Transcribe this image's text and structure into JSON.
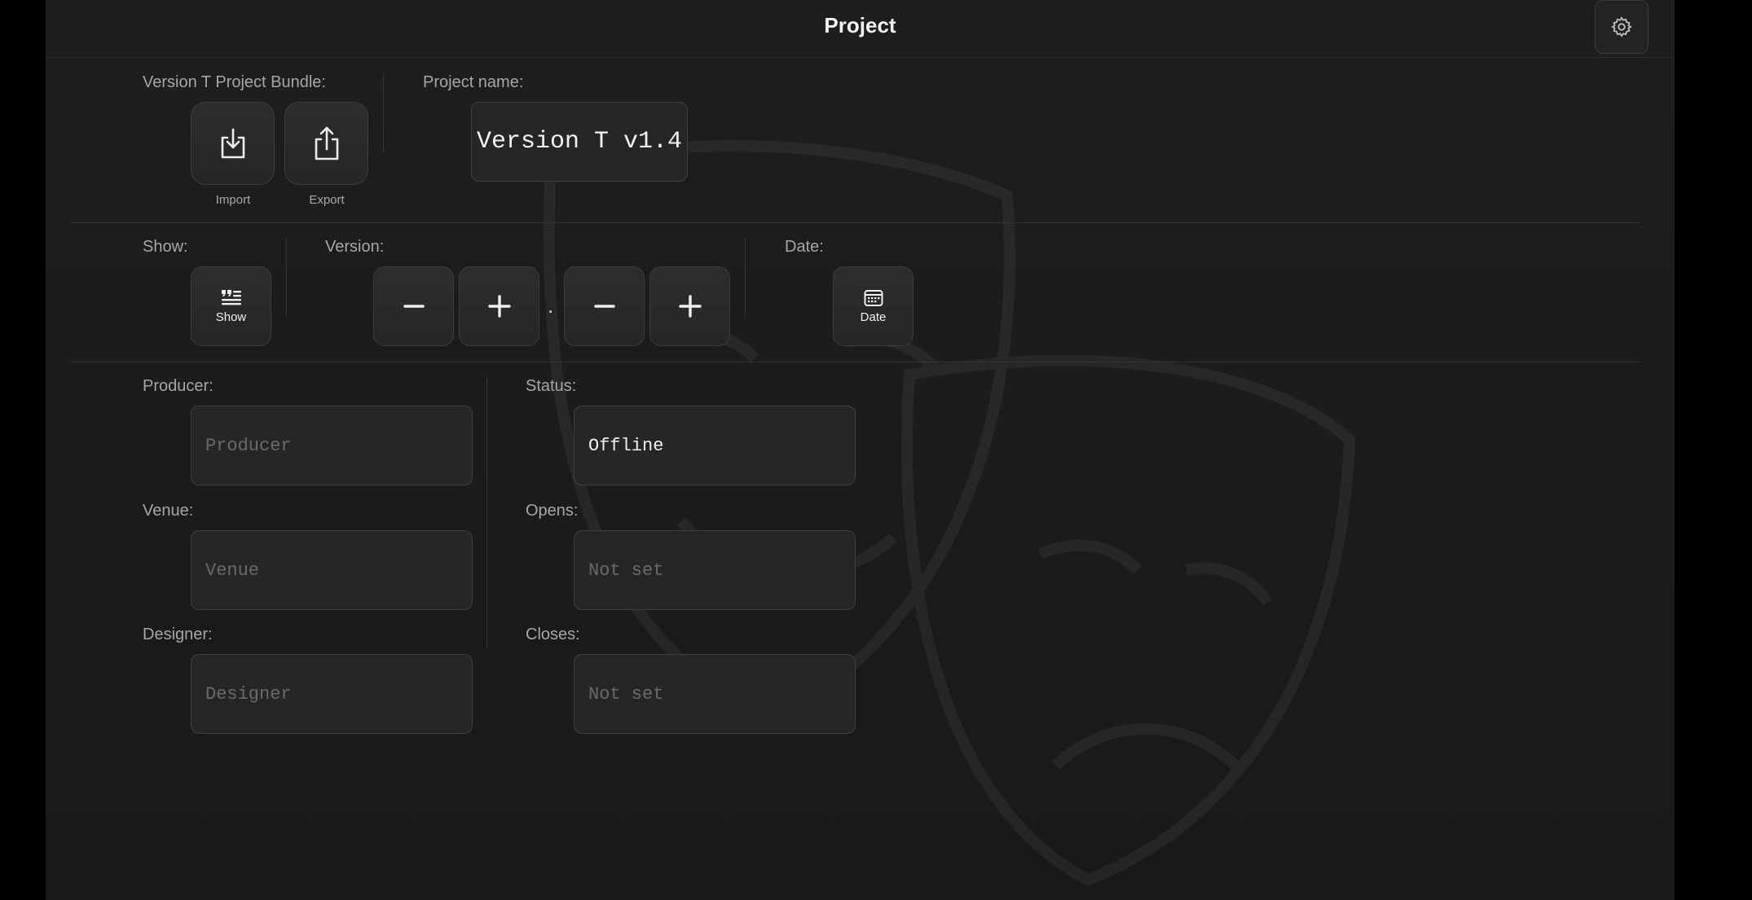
{
  "header": {
    "title": "Project"
  },
  "bundle": {
    "label": "Version T Project Bundle:",
    "import_label": "Import",
    "export_label": "Export"
  },
  "project_name": {
    "label": "Project name:",
    "value": "Version T v1.4"
  },
  "show": {
    "label": "Show:",
    "button_label": "Show"
  },
  "version": {
    "label": "Version:",
    "separator": "."
  },
  "date": {
    "label": "Date:",
    "button_label": "Date"
  },
  "producer": {
    "label": "Producer:",
    "placeholder": "Producer",
    "value": ""
  },
  "venue": {
    "label": "Venue:",
    "placeholder": "Venue",
    "value": ""
  },
  "designer": {
    "label": "Designer:",
    "placeholder": "Designer",
    "value": ""
  },
  "status": {
    "label": "Status:",
    "value": "Offline"
  },
  "opens": {
    "label": "Opens:",
    "placeholder": "Not set",
    "value": ""
  },
  "closes": {
    "label": "Closes:",
    "placeholder": "Not set",
    "value": ""
  },
  "icons": {
    "settings": "gear-icon",
    "import": "download-tray-icon",
    "export": "share-icon",
    "show": "text-quote-icon",
    "date": "calendar-icon",
    "minus": "minus-icon",
    "plus": "plus-icon"
  }
}
